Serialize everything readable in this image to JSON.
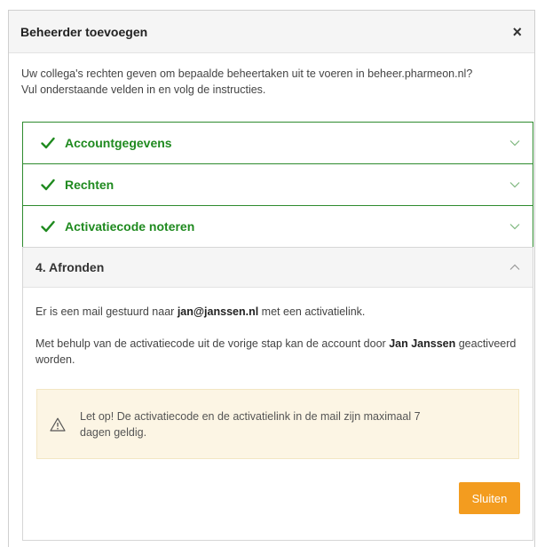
{
  "modal": {
    "title": "Beheerder toevoegen",
    "close_symbol": "×",
    "intro_line1": "Uw collega's rechten geven om bepaalde beheertaken uit te voeren in beheer.pharmeon.nl?",
    "intro_line2": "Vul onderstaande velden in en volg de instructies."
  },
  "steps": [
    {
      "label": "Accountgegevens",
      "status": "completed",
      "icon": "check-icon"
    },
    {
      "label": "Rechten",
      "status": "completed",
      "icon": "check-icon"
    },
    {
      "label": "Activatiecode noteren",
      "status": "completed",
      "icon": "check-icon"
    }
  ],
  "active_step": {
    "label": "4. Afronden",
    "mail_prefix": "Er is een mail gestuurd naar ",
    "mail_address": "jan@janssen.nl",
    "mail_suffix": " met een activatielink.",
    "activation_prefix": "Met behulp van de activatiecode uit de vorige stap kan de account door ",
    "user_name": "Jan Janssen",
    "activation_suffix": " geactiveerd worden.",
    "warning_line1": "Let op! De activatiecode en de activatielink in de mail zijn maximaal 7",
    "warning_line2": "dagen geldig.",
    "close_button": "Sluiten"
  },
  "colors": {
    "success_green": "#1f8a1f",
    "step_border": "#2e8b2e",
    "warning_bg": "#fcf5e4",
    "accent_orange": "#f39c1f"
  }
}
